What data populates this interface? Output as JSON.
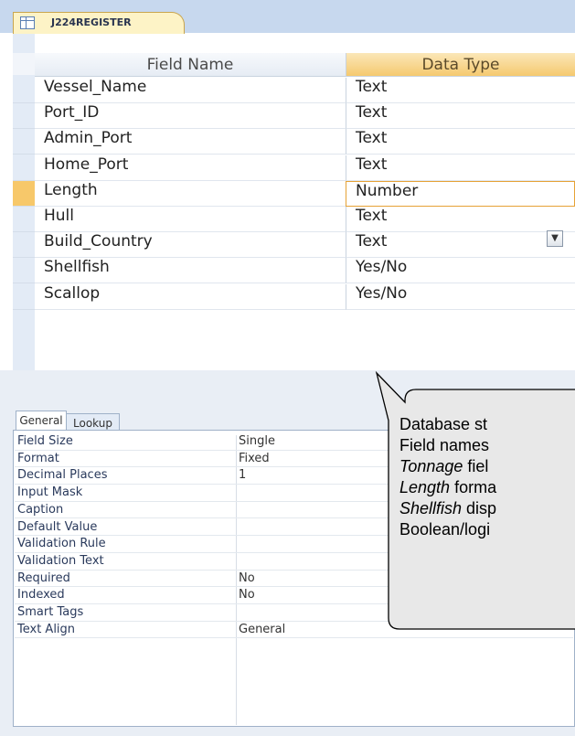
{
  "table_tab": {
    "label": "J224REGISTER",
    "icon": "table-icon"
  },
  "design_grid": {
    "headers": {
      "field_name": "Field Name",
      "data_type": "Data Type"
    },
    "rows": [
      {
        "field": "Vessel_Name",
        "type": "Text"
      },
      {
        "field": "Port_ID",
        "type": "Text"
      },
      {
        "field": "Admin_Port",
        "type": "Text"
      },
      {
        "field": "Home_Port",
        "type": "Text"
      },
      {
        "field": "Length",
        "type": "Number",
        "selected": true
      },
      {
        "field": "Hull",
        "type": "Text"
      },
      {
        "field": "Build_Country",
        "type": "Text"
      },
      {
        "field": "Shellfish",
        "type": "Yes/No"
      },
      {
        "field": "Scallop",
        "type": "Yes/No"
      }
    ],
    "dropdown_icon": "chevron-down-icon"
  },
  "field_properties": {
    "tabs": [
      "General",
      "Lookup"
    ],
    "active_tab": "General",
    "rows": [
      {
        "name": "Field Size",
        "value": "Single"
      },
      {
        "name": "Format",
        "value": "Fixed"
      },
      {
        "name": "Decimal Places",
        "value": "1"
      },
      {
        "name": "Input Mask",
        "value": ""
      },
      {
        "name": "Caption",
        "value": ""
      },
      {
        "name": "Default Value",
        "value": ""
      },
      {
        "name": "Validation Rule",
        "value": ""
      },
      {
        "name": "Validation Text",
        "value": ""
      },
      {
        "name": "Required",
        "value": "No"
      },
      {
        "name": "Indexed",
        "value": "No"
      },
      {
        "name": "Smart Tags",
        "value": ""
      },
      {
        "name": "Text Align",
        "value": "General"
      }
    ]
  },
  "callout": {
    "heading": "Database st",
    "lines": [
      {
        "italic": "",
        "rest": "Field names"
      },
      {
        "italic": "Tonnage",
        "rest": " fiel"
      },
      {
        "italic": "Length",
        "rest": " forma"
      },
      {
        "italic": "Shellfish",
        "rest": " disp"
      },
      {
        "italic": "",
        "rest": "Boolean/logi"
      }
    ]
  }
}
